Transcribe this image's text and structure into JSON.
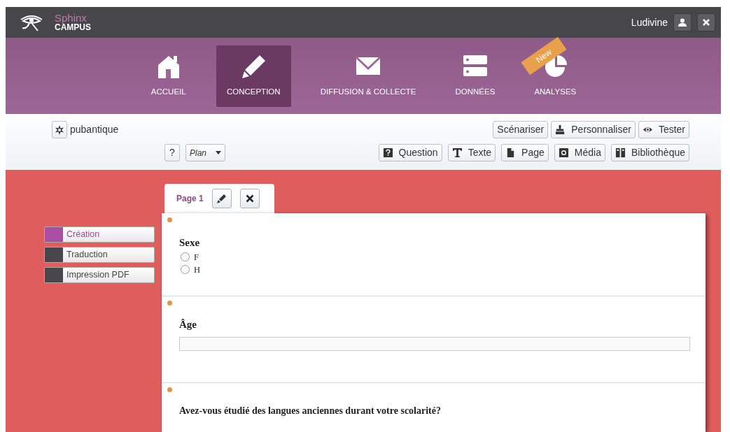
{
  "topbar": {
    "brand": "Sphinx",
    "brand_sub": "CAMPUS",
    "user": "Ludivine"
  },
  "nav": [
    {
      "label": "ACCUEIL",
      "selected": false
    },
    {
      "label": "CONCEPTION",
      "selected": true
    },
    {
      "label": "DIFFUSION & COLLECTE",
      "selected": false
    },
    {
      "label": "DONNÉES",
      "selected": false
    },
    {
      "label": "ANALYSES",
      "selected": false,
      "ribbon": "New"
    }
  ],
  "toolbar": {
    "project": "pubantique",
    "help": "?",
    "plan": "Plan",
    "actions": [
      "Scénariser",
      "Personnaliser",
      "Tester"
    ],
    "inserts": [
      "Question",
      "Texte",
      "Page",
      "Média",
      "Bibliothèque"
    ]
  },
  "side_menu": [
    {
      "label": "Création",
      "selected": true
    },
    {
      "label": "Traduction",
      "selected": false
    },
    {
      "label": "Impression PDF",
      "selected": false
    }
  ],
  "page_tab": {
    "label": "Page 1"
  },
  "questions": [
    {
      "kind": "radio",
      "title": "Sexe",
      "options": [
        {
          "label": "F",
          "checked": false
        },
        {
          "label": "H",
          "checked": false
        }
      ]
    },
    {
      "kind": "text",
      "title": "Âge"
    },
    {
      "kind": "heading",
      "title": "Avez-vous étudié des langues anciennes durant votre scolarité?"
    }
  ]
}
